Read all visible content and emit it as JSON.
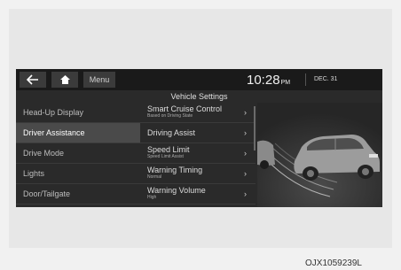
{
  "topbar": {
    "back_icon": "back-arrow-icon",
    "home_icon": "home-icon",
    "menu_label": "Menu",
    "time": "10:28",
    "ampm": "PM",
    "date": "DEC. 31"
  },
  "screen_title": "Vehicle Settings",
  "sidebar": {
    "items": [
      {
        "label": "Head-Up Display",
        "active": false
      },
      {
        "label": "Driver Assistance",
        "active": true
      },
      {
        "label": "Drive Mode",
        "active": false
      },
      {
        "label": "Lights",
        "active": false
      },
      {
        "label": "Door/Tailgate",
        "active": false
      }
    ]
  },
  "options": {
    "items": [
      {
        "label": "Smart Cruise Control",
        "sub": "Based on Driving State"
      },
      {
        "label": "Driving Assist",
        "sub": ""
      },
      {
        "label": "Speed Limit",
        "sub": "Speed Limit Assist"
      },
      {
        "label": "Warning Timing",
        "sub": "Normal"
      },
      {
        "label": "Warning Volume",
        "sub": "High"
      }
    ],
    "chevron_icon": "chevron-right-icon"
  },
  "illustration": "car-sensor-illustration",
  "colors": {
    "screen_bg": "#2a2a2a",
    "topbar_bg": "#1a1a1a",
    "active_item": "#4a4a4a",
    "page_bg": "#f1f1f1"
  },
  "caption": "OJX1059239L"
}
